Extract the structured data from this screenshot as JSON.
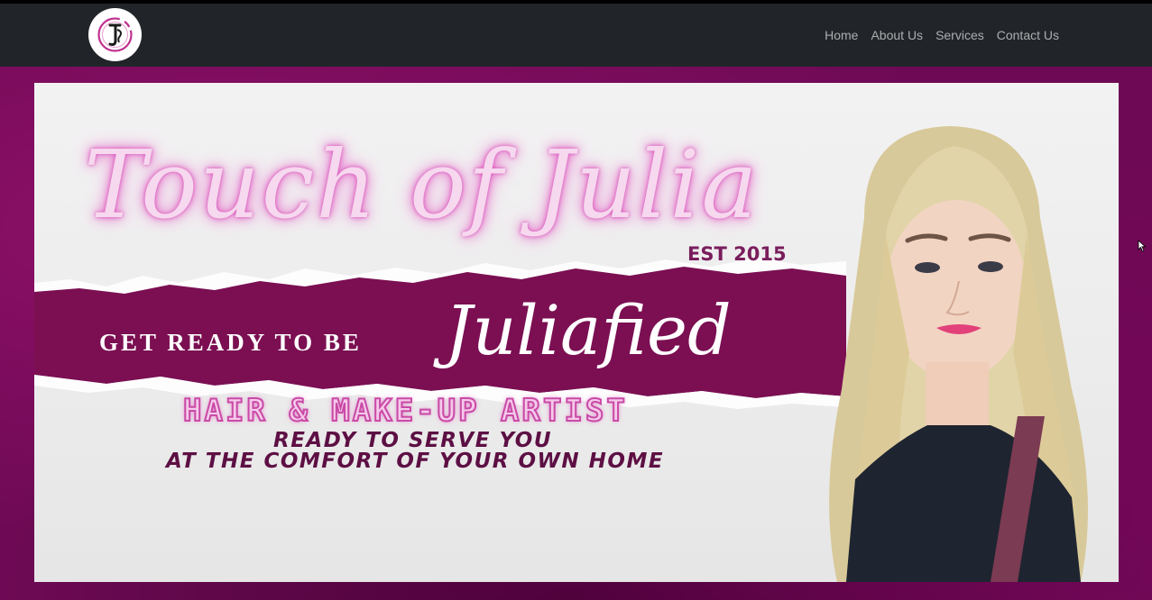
{
  "navbar": {
    "logo_alt": "Touch of Julia logo",
    "links": [
      "Home",
      "About Us",
      "Services",
      "Contact Us"
    ]
  },
  "banner": {
    "title": "Touch of Julia",
    "est": "EST 2015",
    "tagline_lead": "GET READY TO BE",
    "tagline_script": "Juliafied",
    "role": "HAIR & MAKE-UP ARTIST",
    "line1": "READY TO SERVE YOU",
    "line2": "AT THE COMFORT OF YOUR OWN HOME"
  },
  "colors": {
    "navbar_bg": "#212529",
    "hero_bg": "#6e0a55",
    "band": "#7b0f52",
    "accent_pink": "#e266c6"
  }
}
